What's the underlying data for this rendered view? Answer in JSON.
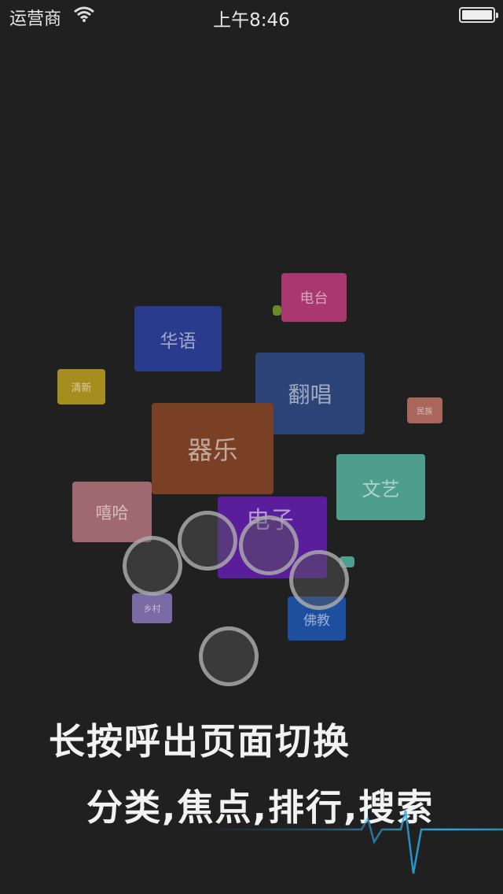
{
  "status": {
    "carrier": "运营商",
    "time": "上午8:46"
  },
  "tiles": {
    "diantai": "电台",
    "huayu": "华语",
    "qingxin": "清新",
    "fanchang": "翻唱",
    "minzu": "民族",
    "qiyue": "器乐",
    "wenyi": "文艺",
    "xiha": "嘻哈",
    "dianzi": "电子",
    "xiangcun": "乡村",
    "fojiao": "佛教",
    "tiny1": "",
    "tiny2": ""
  },
  "hint": {
    "line1": "长按呼出页面切换",
    "line2": "分类,焦点,排行,搜索"
  },
  "colors": {
    "background": "#202020",
    "diantai": "#a8386e",
    "huayu": "#2a3a8c",
    "qingxin": "#a68d1f",
    "fanchang": "#2c4378",
    "minzu": "#a8675a",
    "qiyue": "#7a4026",
    "wenyi": "#4e9e8e",
    "xiha": "#a0696f",
    "dianzi": "#5a1d9c",
    "xiangcun": "#7a6aa6",
    "fojiao": "#1e4f9e",
    "pulse": "#2aa6e0"
  }
}
